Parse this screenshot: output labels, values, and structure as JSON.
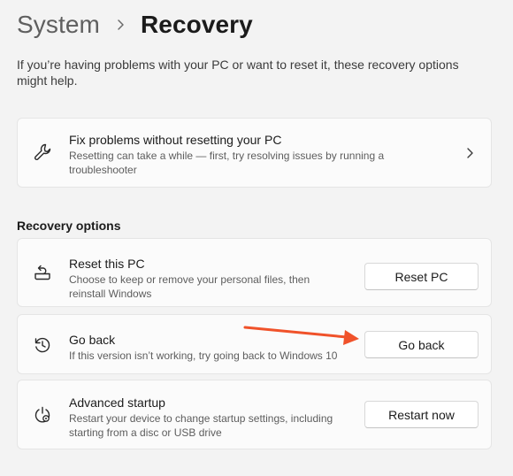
{
  "breadcrumb": {
    "parent": "System",
    "current": "Recovery"
  },
  "intro": "If you’re having problems with your PC or want to reset it, these recovery options might help.",
  "fix_card": {
    "icon": "wrench-icon",
    "title": "Fix problems without resetting your PC",
    "description": "Resetting can take a while — first, try resolving issues by running a troubleshooter"
  },
  "section_title": "Recovery options",
  "options": [
    {
      "icon": "reset-pc-icon",
      "title": "Reset this PC",
      "description": "Choose to keep or remove your personal files, then reinstall Windows",
      "button": "Reset PC"
    },
    {
      "icon": "history-icon",
      "title": "Go back",
      "description": "If this version isn’t working, try going back to Windows 10",
      "button": "Go back"
    },
    {
      "icon": "advanced-startup-icon",
      "title": "Advanced startup",
      "description": "Restart your device to change startup settings, including starting from a disc or USB drive",
      "button": "Restart now"
    }
  ],
  "colors": {
    "background": "#f3f3f3",
    "card": "#fbfbfb",
    "annotation_arrow": "#f0522a"
  }
}
